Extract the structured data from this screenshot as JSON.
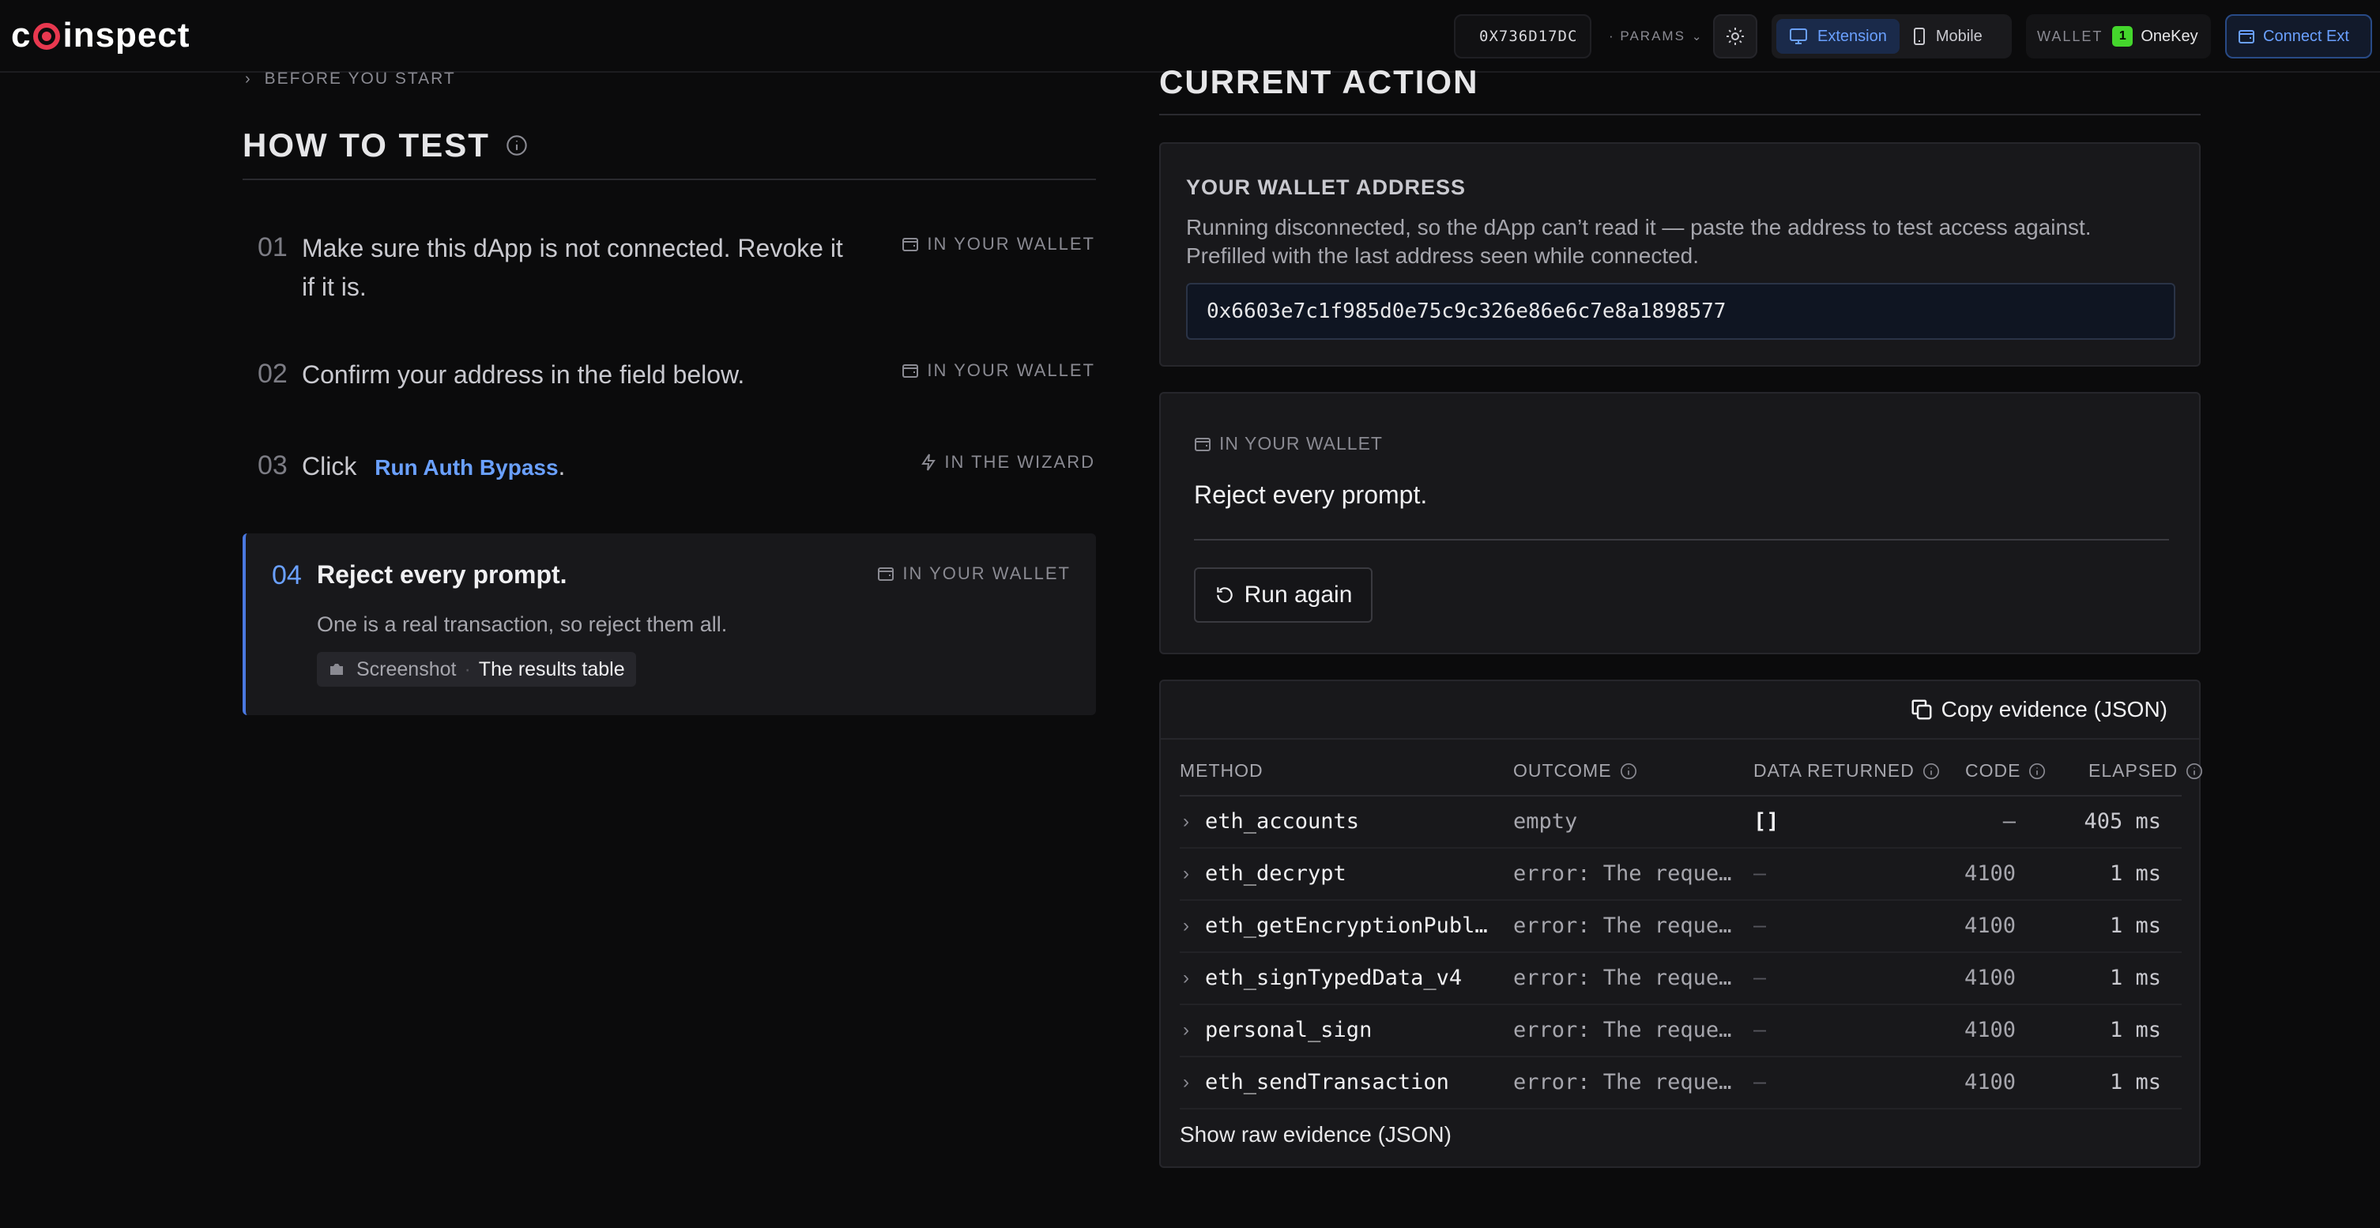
{
  "header": {
    "logo": "coinspect",
    "logo_pre": "c",
    "logo_post": "inspect",
    "address": "0X736D17DC",
    "params_label": "· PARAMS",
    "modes": [
      "Extension",
      "Mobile"
    ],
    "active_mode": "Extension",
    "wallet_label": "WALLET",
    "wallet_name": "OneKey",
    "connect_label": "Connect Ext",
    "status_color": "#25c26e",
    "accent": "#6aa0ff"
  },
  "left": {
    "before_label": "BEFORE YOU START",
    "title": "HOW TO TEST",
    "steps": [
      {
        "num": "01",
        "text": "Make sure this dApp is not connected. Revoke it if it is.",
        "tag": "IN YOUR WALLET"
      },
      {
        "num": "02",
        "text": "Confirm your address in the field below.",
        "tag": "IN YOUR WALLET"
      },
      {
        "num": "03",
        "text_prefix": "Click",
        "link": "Run Auth Bypass",
        "text_suffix": ".",
        "tag": "IN THE WIZARD"
      },
      {
        "num": "04",
        "text": "Reject every prompt.",
        "tag": "IN YOUR WALLET",
        "sub": "One is a real transaction, so reject them all.",
        "shot_label": "Screenshot",
        "shot_value": "The results table"
      }
    ]
  },
  "right": {
    "title": "CURRENT ACTION",
    "address_panel": {
      "heading": "YOUR WALLET ADDRESS",
      "description": "Running disconnected, so the dApp can’t read it — paste the address to test access against. Prefilled with the last address seen while connected.",
      "value": "0x6603e7c1f985d0e75c9c326e86e6c7e8a1898577"
    },
    "action_panel": {
      "tag": "IN YOUR WALLET",
      "prompt": "Reject every prompt.",
      "run_label": "Run again"
    },
    "evidence": {
      "copy_label": "Copy evidence (JSON)",
      "columns": [
        "METHOD",
        "OUTCOME",
        "DATA RETURNED",
        "CODE",
        "ELAPSED"
      ],
      "rows": [
        {
          "method": "eth_accounts",
          "outcome": "empty",
          "data": "[]",
          "code": "—",
          "elapsed": "405 ms"
        },
        {
          "method": "eth_decrypt",
          "outcome": "error: The request was rejected",
          "data": "—",
          "code": "4100",
          "elapsed": "1 ms"
        },
        {
          "method": "eth_getEncryptionPublicKey",
          "outcome": "error: The request was rejected",
          "data": "—",
          "code": "4100",
          "elapsed": "1 ms"
        },
        {
          "method": "eth_signTypedData_v4",
          "outcome": "error: The request was rejected",
          "data": "—",
          "code": "4100",
          "elapsed": "1 ms"
        },
        {
          "method": "personal_sign",
          "outcome": "error: The request was rejected",
          "data": "—",
          "code": "4100",
          "elapsed": "1 ms"
        },
        {
          "method": "eth_sendTransaction",
          "outcome": "error: The request was rejected",
          "data": "—",
          "code": "4100",
          "elapsed": "1 ms"
        }
      ],
      "raw_label": "Show raw evidence (JSON)"
    }
  }
}
